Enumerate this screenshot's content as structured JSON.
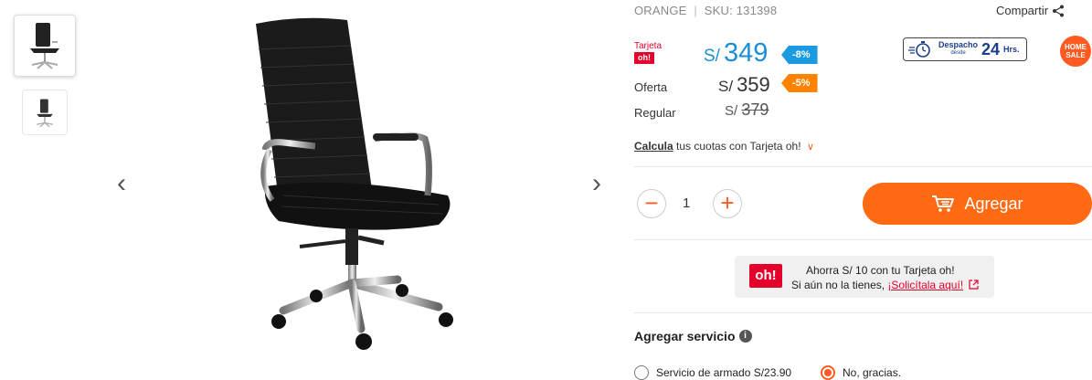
{
  "gallery": {
    "prev_label": "‹",
    "next_label": "›"
  },
  "product": {
    "brand": "ORANGE",
    "separator": "|",
    "sku": "SKU: 131398",
    "share_label": "Compartir"
  },
  "prices": {
    "tarjeta_label": "Tarjeta",
    "oh_label": "oh!",
    "currency": "S/",
    "tarjeta_value": "349",
    "tarjeta_discount": "-8%",
    "oferta_label": "Oferta",
    "oferta_value": "359",
    "oferta_discount": "-5%",
    "regular_label": "Regular",
    "regular_value": "379"
  },
  "badges": {
    "despacho_label": "Despacho",
    "despacho_sub": "desde",
    "despacho_hours": "24",
    "despacho_hrs": "Hrs.",
    "home_sale_1": "HOME",
    "home_sale_2": "SALE"
  },
  "calc": {
    "link": "Calcula",
    "text": " tus cuotas con Tarjeta oh!"
  },
  "cart": {
    "minus": "−",
    "quantity": "1",
    "plus": "+",
    "add_label": "Agregar"
  },
  "promo": {
    "logo": "oh!",
    "line1": "Ahorra S/ 10 con tu Tarjeta oh!",
    "line2_prefix": "Si aún no la tienes, ",
    "line2_link": "¡Solicítala aquí!"
  },
  "services": {
    "title": "Agregar servicio",
    "info": "i",
    "option1": "Servicio de armado S/23.90",
    "option2": "No, gracias."
  },
  "colors": {
    "accent": "#ff6a13",
    "oh_red": "#e4002b",
    "tarjeta_blue": "#1a8ed8"
  }
}
